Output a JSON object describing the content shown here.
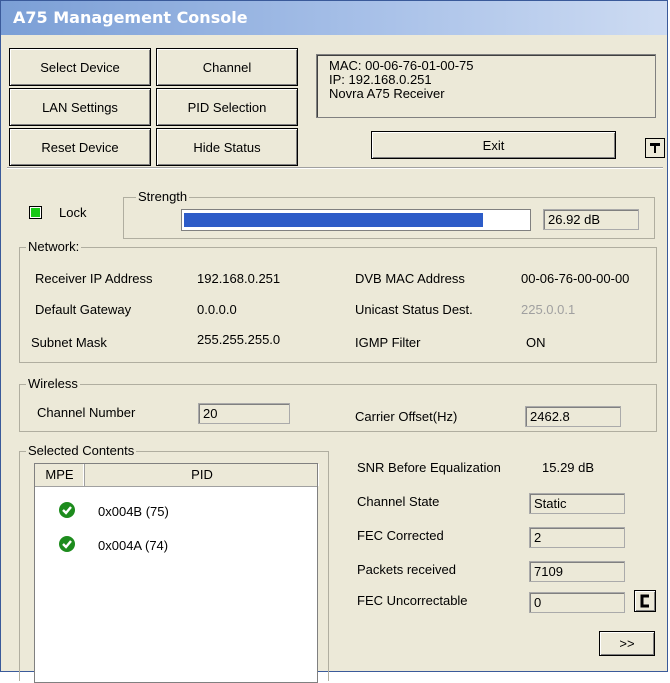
{
  "window": {
    "title": "A75 Management Console"
  },
  "buttons": {
    "select_device": "Select Device",
    "channel": "Channel",
    "lan_settings": "LAN Settings",
    "pid_selection": "PID Selection",
    "reset_device": "Reset Device",
    "hide_status": "Hide Status",
    "exit": "Exit",
    "next": ">>"
  },
  "device_info": {
    "mac": "MAC: 00-06-76-01-00-75",
    "ip": "IP: 192.168.0.251",
    "name": "Novra A75 Receiver"
  },
  "status": {
    "lock_label": "Lock",
    "lock_state": true,
    "lock_color": "#18c918",
    "strength_title": "Strength",
    "strength_fraction": 0.87,
    "strength_value": "26.92 dB",
    "bar_color": "#2d5cc8"
  },
  "network": {
    "title": "Network:",
    "receiver_ip_label": "Receiver IP Address",
    "receiver_ip": "192.168.0.251",
    "gateway_label": "Default Gateway",
    "gateway": "0.0.0.0",
    "subnet_label": "Subnet Mask",
    "subnet": "255.255.255.0",
    "dvb_mac_label": "DVB MAC Address",
    "dvb_mac": "00-06-76-00-00-00",
    "unicast_label": "Unicast Status Dest.",
    "unicast": "225.0.0.1",
    "igmp_label": "IGMP Filter",
    "igmp": "ON"
  },
  "wireless": {
    "title": "Wireless",
    "channel_number_label": "Channel Number",
    "channel_number": "20",
    "carrier_offset_label": "Carrier Offset(Hz)",
    "carrier_offset": "2462.8"
  },
  "contents": {
    "title": "Selected Contents",
    "col_mpe": "MPE",
    "col_pid": "PID",
    "rows": [
      {
        "pid": "0x004B (75)",
        "mpe_icon": "check-icon"
      },
      {
        "pid": "0x004A (74)",
        "mpe_icon": "check-icon"
      }
    ]
  },
  "stats": {
    "snr_label": "SNR Before Equalization",
    "snr": "15.29 dB",
    "channel_state_label": "Channel State",
    "channel_state": "Static",
    "fec_corrected_label": "FEC Corrected",
    "fec_corrected": "2",
    "packets_label": "Packets received",
    "packets": "7109",
    "fec_uncorrectable_label": "FEC Uncorrectable",
    "fec_uncorrectable": "0"
  },
  "icons": {
    "pin": "pin-icon",
    "reset_counter": "reset-counter-icon"
  }
}
